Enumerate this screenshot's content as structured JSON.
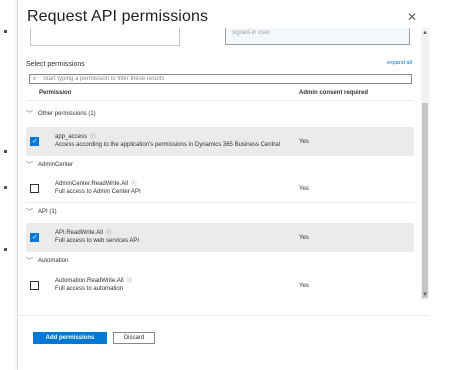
{
  "dialog": {
    "title": "Request API permissions",
    "close_glyph": "✕",
    "prev_field_text": "signed-in user."
  },
  "permissions": {
    "select_label": "Select permissions",
    "expand_all": "expand all",
    "search_placeholder": "Start typing a permission to filter these results",
    "col_permission": "Permission",
    "col_consent": "Admin consent required"
  },
  "groups": [
    {
      "name": "Other permissions (1)",
      "items": [
        {
          "name": "app_access",
          "description": "Access according to the application's permissions in Dynamics 365 Business Central",
          "consent": "Yes",
          "checked": true
        }
      ]
    },
    {
      "name": "AdminCenter",
      "items": [
        {
          "name": "AdminCenter.ReadWrite.All",
          "description": "Full access to Admin Center API",
          "consent": "Yes",
          "checked": false
        }
      ]
    },
    {
      "name": "API (1)",
      "items": [
        {
          "name": "API.ReadWrite.All",
          "description": "Full access to web services API",
          "consent": "Yes",
          "checked": true
        }
      ]
    },
    {
      "name": "Automation",
      "items": [
        {
          "name": "Automation.ReadWrite.All",
          "description": "Full access to automation",
          "consent": "Yes",
          "checked": false
        }
      ]
    }
  ],
  "footer": {
    "add_label": "Add permissions",
    "discard_label": "Discard"
  },
  "colors": {
    "accent": "#0078d4",
    "selected_row": "#edebe9"
  }
}
